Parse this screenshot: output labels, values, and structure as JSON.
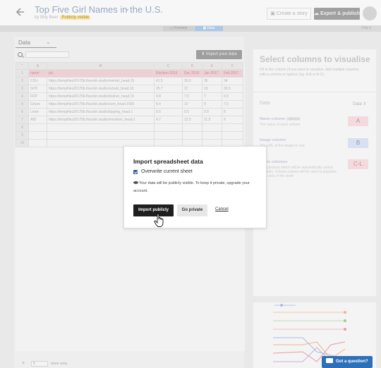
{
  "header": {
    "title": "Top Five Girl Names in the U.S.",
    "byline": "by Billy Beer",
    "visibility_badge": "Publicly visible",
    "create_story": "Create a story",
    "export_publish": "Export & publish"
  },
  "view_toggle": {
    "preview": "Preview",
    "data": "Data",
    "hide": "Hide"
  },
  "sheet": {
    "tab_label": "Data",
    "import_button": "Import your data",
    "columns": [
      "A",
      "B",
      "C",
      "D",
      "E",
      "F"
    ],
    "rows": [
      [
        "name",
        "pic",
        "Election 2013",
        "Dec 2016",
        "Jan 2017",
        "Feb 2017"
      ],
      [
        "CDU",
        "https://tempfiles20170b.flourish.studio/merkel_head.15",
        "41.5",
        "35.5",
        "36",
        "34"
      ],
      [
        "SPD",
        "https://tempfiles20170b.flourish.studio/schulz_head.10",
        "25.7",
        "22",
        "23",
        "30.5"
      ],
      [
        "FDP",
        "https://tempfiles20170b.flourish.studio/lindner_head.15",
        "4.8",
        "7.5",
        "7",
        "6.5"
      ],
      [
        "Grüne",
        "https://tempfiles20170b.flourish.studio/cem_head.1500",
        "8.4",
        "10",
        "9",
        "7.5"
      ],
      [
        "Linke",
        "https://tempfiles20170b.flourish.studio/kipping_head.1",
        "8.6",
        "9.5",
        "9.5",
        "8"
      ],
      [
        "AfD",
        "https://tempfiles20170b.flourish.studio/meuthen_head.1",
        "4.7",
        "12.5",
        "11.5",
        "9"
      ],
      [
        "",
        "",
        "",
        "",
        "",
        ""
      ],
      [
        "",
        "",
        "",
        "",
        "",
        ""
      ],
      [
        "",
        "",
        "",
        "",
        "",
        ""
      ]
    ],
    "row_numbers": [
      "1",
      "2",
      "3",
      "4",
      "5",
      "6",
      "7",
      "8",
      "9",
      "10"
    ],
    "footer_count": "5",
    "footer_more": "more rows"
  },
  "right_panel": {
    "title": "Select columns to visualise",
    "description": "Fill in the column (if you want to visualise. Add multiple columns with a comma or hyphen (eg. A,B or A-C).",
    "data_label": "Data",
    "data_select": "Data ⇕",
    "name_column": {
      "label": "Name column",
      "optional": "optional",
      "sub": "The name of each entrant",
      "value": "A"
    },
    "image_column": {
      "label": "Image column",
      "sub": "The URL of the image to use",
      "value": "B"
    },
    "score_columns": {
      "label": "Score columns",
      "sub": "Any columns which will be automatically sorted as ranks. Column names will be used to populate the x-axis of the chart",
      "value": "C-L"
    }
  },
  "modal": {
    "title": "Import spreadsheet data",
    "checkbox_label": "Overwrite current sheet",
    "checkbox_checked": true,
    "notice": "Your data will be publicly visible. To keep it private, upgrade your account.",
    "import_publicly": "Import publicly",
    "go_private": "Go private",
    "cancel": "Cancel"
  },
  "help": {
    "label": "Got a question?"
  },
  "colors": {
    "accent_blue": "#2a5fa5",
    "help_blue": "#2d6fb8",
    "header_row_pink": "#eecfd5",
    "primary_dark": "#1e1e1e"
  }
}
